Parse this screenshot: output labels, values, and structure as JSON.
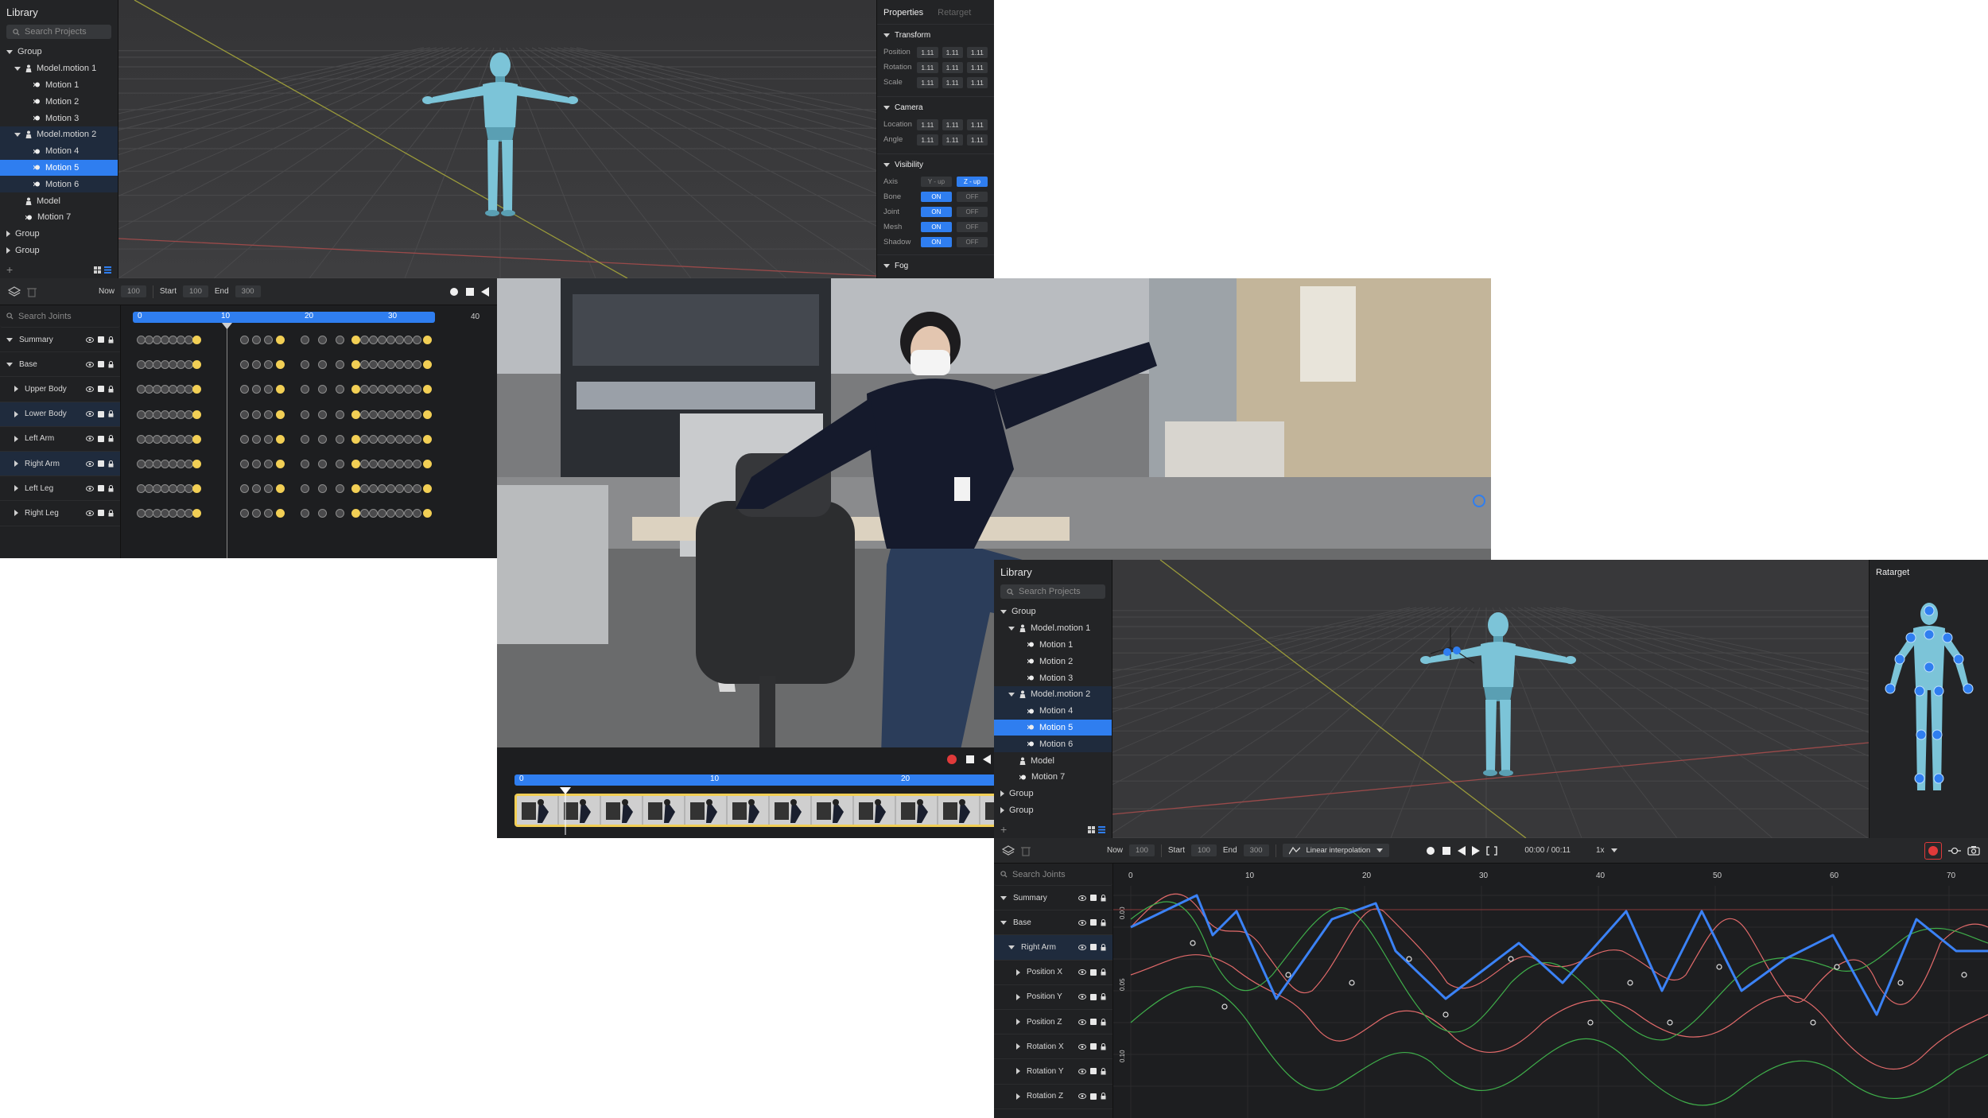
{
  "top_left": {
    "library": {
      "title": "Library",
      "search_placeholder": "Search Projects",
      "tree": [
        {
          "label": "Group",
          "level": 0,
          "kind": "group",
          "expanded": true
        },
        {
          "label": "Model.motion 1",
          "level": 1,
          "kind": "model",
          "expanded": true
        },
        {
          "label": "Motion 1",
          "level": 2,
          "kind": "motion"
        },
        {
          "label": "Motion 2",
          "level": 2,
          "kind": "motion"
        },
        {
          "label": "Motion 3",
          "level": 2,
          "kind": "motion"
        },
        {
          "label": "Model.motion 2",
          "level": 1,
          "kind": "model",
          "expanded": true,
          "state": "hl"
        },
        {
          "label": "Motion 4",
          "level": 2,
          "kind": "motion",
          "state": "hl"
        },
        {
          "label": "Motion 5",
          "level": 2,
          "kind": "motion",
          "state": "sel"
        },
        {
          "label": "Motion 6",
          "level": 2,
          "kind": "motion",
          "state": "hl"
        },
        {
          "label": "Model",
          "level": 1,
          "kind": "model-plain"
        },
        {
          "label": "Motion 7",
          "level": 1,
          "kind": "motion"
        },
        {
          "label": "Group",
          "level": 0,
          "kind": "group",
          "expanded": false
        },
        {
          "label": "Group",
          "level": 0,
          "kind": "group",
          "expanded": false
        }
      ]
    },
    "properties": {
      "tab_active": "Properties",
      "tab_inactive": "Retarget",
      "transform_title": "Transform",
      "transform_rows": [
        "Position",
        "Rotation",
        "Scale"
      ],
      "camera_title": "Camera",
      "camera_rows": [
        "Location",
        "Angle"
      ],
      "field_value": "1.11",
      "visibility_title": "Visibility",
      "axis_label": "Axis",
      "axis_options": [
        "Y - up",
        "Z - up"
      ],
      "toggle_rows": [
        "Bone",
        "Joint",
        "Mesh",
        "Shadow"
      ],
      "on_label": "ON",
      "off_label": "OFF",
      "fog_title": "Fog"
    },
    "timeline": {
      "now_label": "Now",
      "now_value": "100",
      "start_label": "Start",
      "start_value": "100",
      "end_label": "End",
      "end_value": "300",
      "search_placeholder": "Search Joints",
      "ruler_ticks": [
        "0",
        "10",
        "20",
        "30",
        "40"
      ],
      "joints": [
        {
          "label": "Summary",
          "caret": "down",
          "indent": 0
        },
        {
          "label": "Base",
          "caret": "down",
          "indent": 0
        },
        {
          "label": "Upper Body",
          "caret": "right",
          "indent": 1
        },
        {
          "label": "Lower Body",
          "caret": "right",
          "indent": 1,
          "state": "hl"
        },
        {
          "label": "Left Arm",
          "caret": "right",
          "indent": 1
        },
        {
          "label": "Right Arm",
          "caret": "right",
          "indent": 1,
          "state": "hl"
        },
        {
          "label": "Left Leg",
          "caret": "right",
          "indent": 1
        },
        {
          "label": "Right Leg",
          "caret": "right",
          "indent": 1
        }
      ]
    }
  },
  "video": {
    "ruler_ticks": [
      "0",
      "10",
      "20"
    ],
    "playhead_fraction": 0.1
  },
  "bottom_right": {
    "library": {
      "title": "Library",
      "search_placeholder": "Search Projects",
      "tree": [
        {
          "label": "Group",
          "level": 0,
          "kind": "group",
          "expanded": true
        },
        {
          "label": "Model.motion 1",
          "level": 1,
          "kind": "model",
          "expanded": true
        },
        {
          "label": "Motion 1",
          "level": 2,
          "kind": "motion"
        },
        {
          "label": "Motion 2",
          "level": 2,
          "kind": "motion"
        },
        {
          "label": "Motion 3",
          "level": 2,
          "kind": "motion"
        },
        {
          "label": "Model.motion 2",
          "level": 1,
          "kind": "model",
          "expanded": true,
          "state": "hl"
        },
        {
          "label": "Motion 4",
          "level": 2,
          "kind": "motion",
          "state": "hl"
        },
        {
          "label": "Motion 5",
          "level": 2,
          "kind": "motion",
          "state": "sel"
        },
        {
          "label": "Motion 6",
          "level": 2,
          "kind": "motion",
          "state": "hl"
        },
        {
          "label": "Model",
          "level": 1,
          "kind": "model-plain"
        },
        {
          "label": "Motion 7",
          "level": 1,
          "kind": "motion"
        },
        {
          "label": "Group",
          "level": 0,
          "kind": "group",
          "expanded": false
        },
        {
          "label": "Group",
          "level": 0,
          "kind": "group",
          "expanded": false
        }
      ]
    },
    "retarget_title": "Ratarget",
    "toolbar": {
      "now_label": "Now",
      "now_value": "100",
      "start_label": "Start",
      "start_value": "100",
      "end_label": "End",
      "end_value": "300",
      "interpolation": "Linear interpolation",
      "time": "00:00 / 00:11",
      "speed": "1x"
    },
    "joints_search_placeholder": "Search Joints",
    "joints": [
      {
        "label": "Summary",
        "caret": "down",
        "indent": 0
      },
      {
        "label": "Base",
        "caret": "down",
        "indent": 0
      },
      {
        "label": "Right Arm",
        "caret": "down",
        "indent": 1,
        "state": "hl"
      },
      {
        "label": "Position X",
        "caret": "right",
        "indent": 2
      },
      {
        "label": "Position Y",
        "caret": "right",
        "indent": 2
      },
      {
        "label": "Position Z",
        "caret": "right",
        "indent": 2
      },
      {
        "label": "Rotation X",
        "caret": "right",
        "indent": 2
      },
      {
        "label": "Rotation Y",
        "caret": "right",
        "indent": 2
      },
      {
        "label": "Rotation Z",
        "caret": "right",
        "indent": 2
      }
    ],
    "graph_ticks": [
      "0",
      "10",
      "20",
      "30",
      "40",
      "50",
      "60",
      "70"
    ],
    "graph_y_labels": [
      "0.00",
      "0.05",
      "0.10"
    ]
  },
  "colors": {
    "accent": "#2f7ef0",
    "key_yellow": "#f2cf55",
    "curve_blue": "#3b82f6",
    "curve_red": "#e26a6a",
    "curve_green": "#3fae4a",
    "model": "#7cc4d8"
  }
}
